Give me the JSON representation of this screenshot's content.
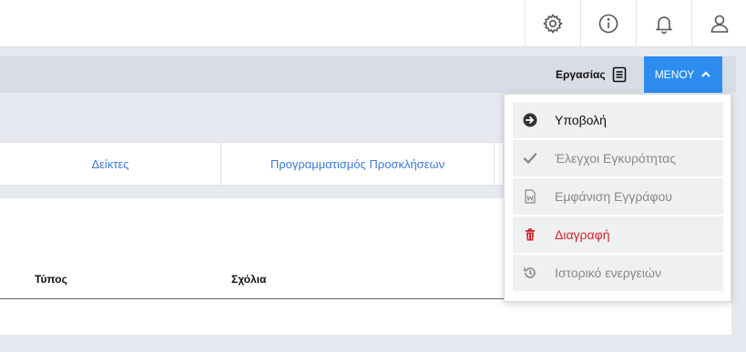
{
  "header": {
    "icons": [
      "gear-icon",
      "info-icon",
      "bell-icon",
      "user-icon"
    ]
  },
  "actionbar": {
    "tasks_label": "Εργασίας",
    "menu_label": "ΜΕΝΟΥ"
  },
  "tabs": [
    {
      "label": "Δείκτες"
    },
    {
      "label": "Προγραμματισμός Προσκλήσεων"
    }
  ],
  "table": {
    "columns": [
      "Τύπος",
      "Σχόλια"
    ]
  },
  "menu": {
    "items": [
      {
        "label": "Υποβολή",
        "icon": "arrow-circle-right-icon",
        "state": "active"
      },
      {
        "label": "Έλεγχοι Εγκυρότητας",
        "icon": "check-icon",
        "state": "disabled"
      },
      {
        "label": "Εμφάνιση Εγγράφου",
        "icon": "word-document-icon",
        "state": "disabled"
      },
      {
        "label": "Διαγραφή",
        "icon": "trash-icon",
        "state": "danger"
      },
      {
        "label": "Ιστορικό ενεργειών",
        "icon": "history-icon",
        "state": "disabled"
      }
    ]
  },
  "colors": {
    "accent": "#2d8cf0",
    "tab_text": "#3a7bd5",
    "danger": "#d3242c"
  }
}
